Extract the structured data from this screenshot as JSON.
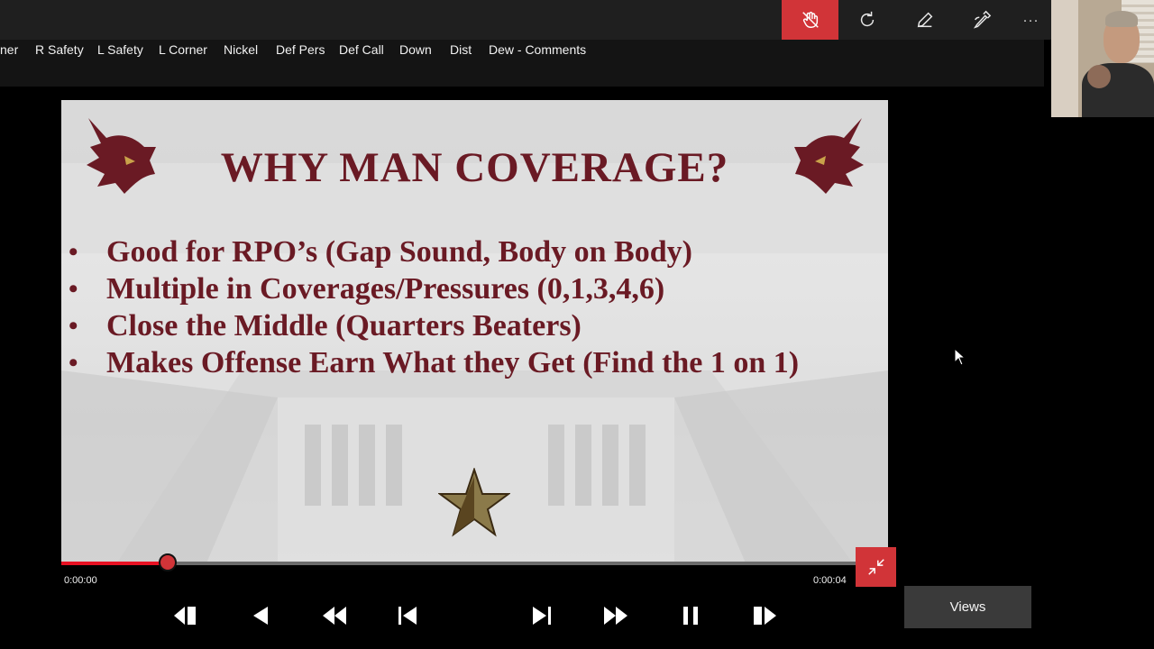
{
  "toolbar": {
    "buttons": [
      {
        "name": "touch-hand-icon",
        "active": true
      },
      {
        "name": "redo-icon",
        "active": false
      },
      {
        "name": "pen-icon",
        "active": false
      },
      {
        "name": "marker-icon",
        "active": false
      },
      {
        "name": "more-icon",
        "active": false
      }
    ],
    "more_label": "···",
    "accent": "#d13438"
  },
  "columns": [
    "ner",
    "R Safety",
    "L Safety",
    "L Corner",
    "Nickel",
    "Def Pers",
    "Def Call",
    "Down",
    "Dist",
    "Dew - Comments"
  ],
  "slide": {
    "title": "WHY MAN COVERAGE?",
    "bullets": [
      "Good for RPO’s (Gap Sound, Body on Body)",
      "Multiple in Coverages/Pressures (0,1,3,4,6)",
      "Close the Middle (Quarters Beaters)",
      "Makes Offense Earn What they Get (Find the 1 on 1)"
    ],
    "text_color": "#6a1a24",
    "logo_color": "#6a1a24",
    "star_color": "#8b7a4a"
  },
  "playback": {
    "current_time": "0:00:00",
    "total_time": "0:00:04",
    "progress_fraction": 0.129,
    "track_color": "#e81123",
    "controls": [
      "skip-back-frame-icon",
      "step-back-icon",
      "rewind-icon",
      "previous-icon",
      "next-icon",
      "fast-forward-icon",
      "pause-icon",
      "step-forward-icon"
    ]
  },
  "views_label": "Views"
}
